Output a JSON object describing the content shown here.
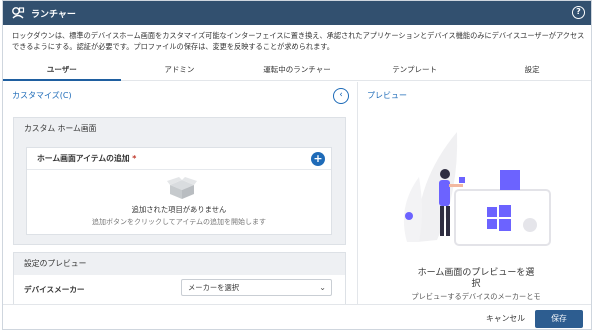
{
  "window": {
    "title": "ランチャー",
    "help_icon": "question-circle-icon"
  },
  "description": "ロックダウンは、標準のデバイスホーム画面をカスタマイズ可能なインターフェイスに置き換え、承認されたアプリケーションとデバイス機能のみにデバイスユーザーがアクセスできるようにする。認証が必要です。プロファイルの保存は、変更を反映することが求められます。",
  "tabs": [
    {
      "label": "ユーザー",
      "active": true
    },
    {
      "label": "アドミン",
      "active": false
    },
    {
      "label": "運転中のランチャー",
      "active": false
    },
    {
      "label": "テンプレート",
      "active": false
    },
    {
      "label": "設定",
      "active": false
    }
  ],
  "left": {
    "customize_link": "カスタマイズ(C)",
    "collapse_icon": "chevron-left-icon",
    "home_panel": {
      "title": "カスタム ホーム画面",
      "add_section_title": "ホーム画面アイテムの追加",
      "required_mark": "*",
      "add_icon": "plus-icon",
      "empty_title": "追加された項目がありません",
      "empty_subtitle": "追加ボタンをクリックしてアイテムの追加を開始します"
    },
    "settings_preview": {
      "title": "設定のプレビュー",
      "device_maker_label": "デバイスメーカー",
      "device_maker_value": "メーカーを選択"
    }
  },
  "right": {
    "preview_title": "プレビュー",
    "empty_title_line1": "ホーム画面のプレビューを選",
    "empty_title_line2": "択",
    "empty_subtitle": "プレビューするデバイスのメーカーとモ"
  },
  "footer": {
    "cancel_label": "キャンセル",
    "save_label": "保存"
  },
  "colors": {
    "titlebar": "#32506f",
    "accent": "#1e6bb8",
    "save_button": "#2d5d90",
    "illustration_purple": "#6c63ff"
  }
}
